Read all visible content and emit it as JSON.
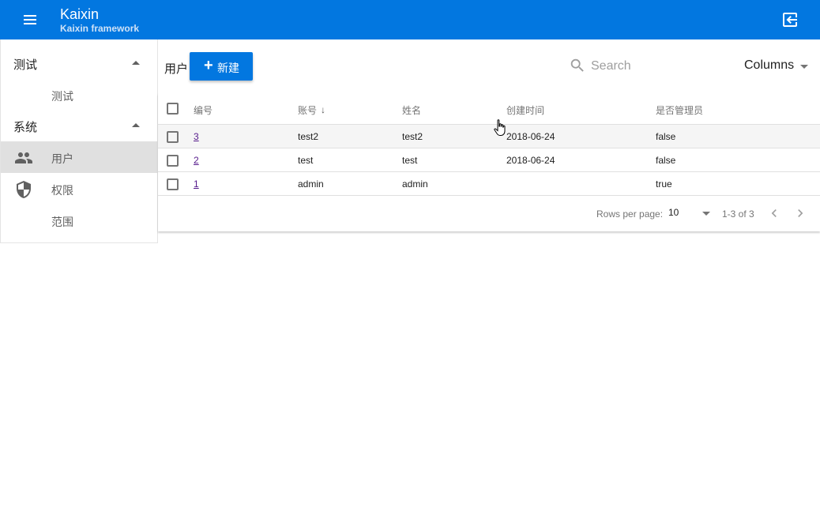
{
  "appbar": {
    "title": "Kaixin",
    "subtitle": "Kaixin framework",
    "color": "#0277e0"
  },
  "sidebar": {
    "groups": [
      {
        "label": "测试",
        "items": [
          {
            "label": "测试",
            "icon": ""
          }
        ]
      },
      {
        "label": "系统",
        "items": [
          {
            "label": "用户",
            "icon": "people-icon",
            "active": true
          },
          {
            "label": "权限",
            "icon": "shield-icon"
          },
          {
            "label": "范围",
            "icon": ""
          }
        ]
      }
    ]
  },
  "toolbar": {
    "page_title": "用户",
    "new_label": "新建",
    "search_placeholder": "Search",
    "columns_label": "Columns"
  },
  "table": {
    "columns": [
      "编号",
      "账号",
      "姓名",
      "创建时间",
      "是否管理员"
    ],
    "sorted_column": "账号",
    "rows": [
      {
        "id": "3",
        "account": "test2",
        "name": "test2",
        "created": "2018-06-24",
        "admin": "false"
      },
      {
        "id": "2",
        "account": "test",
        "name": "test",
        "created": "2018-06-24",
        "admin": "false"
      },
      {
        "id": "1",
        "account": "admin",
        "name": "admin",
        "created": "",
        "admin": "true"
      }
    ]
  },
  "pagination": {
    "rows_per_page_label": "Rows per page:",
    "rows_per_page": "10",
    "range": "1-3 of 3"
  }
}
